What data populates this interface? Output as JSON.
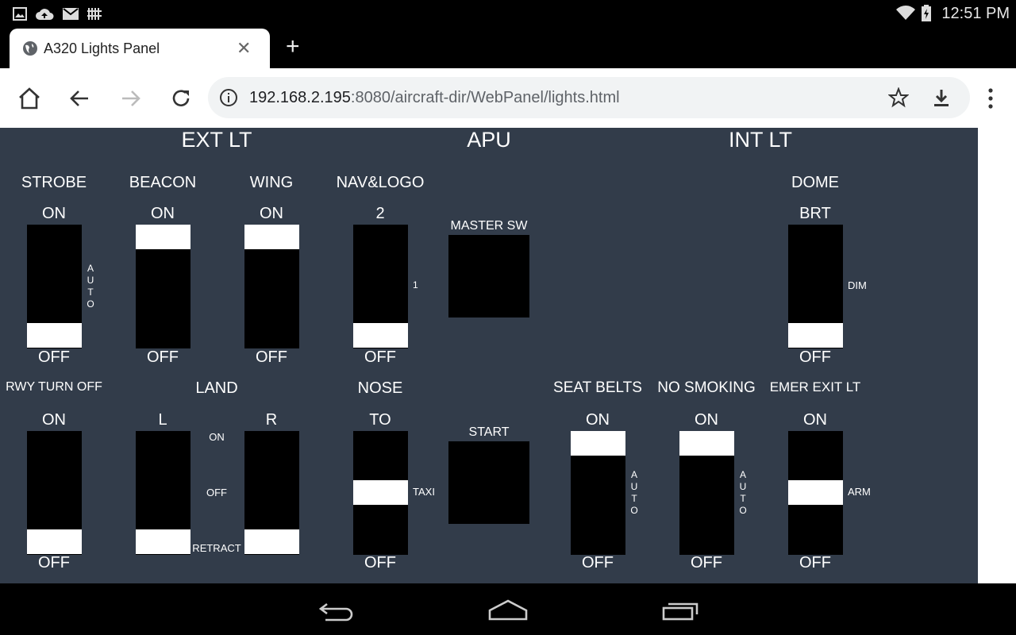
{
  "status_bar": {
    "time": "12:51 PM"
  },
  "browser": {
    "tab_title": "A320 Lights Panel",
    "url_host": "192.168.2.195",
    "url_path": ":8080/aircraft-dir/WebPanel/lights.html"
  },
  "panel": {
    "sections": {
      "ext_lt": "EXT LT",
      "apu": "APU",
      "int_lt": "INT LT"
    },
    "strobe": {
      "title": "STROBE",
      "top": "ON",
      "bottom": "OFF",
      "mid": "AUTO",
      "position": "OFF"
    },
    "beacon": {
      "title": "BEACON",
      "top": "ON",
      "bottom": "OFF",
      "position": "ON"
    },
    "wing": {
      "title": "WING",
      "top": "ON",
      "bottom": "OFF",
      "position": "ON"
    },
    "nav_logo": {
      "title": "NAV&LOGO",
      "top": "2",
      "bottom": "OFF",
      "mid": "1",
      "position": "OFF"
    },
    "apu_master": {
      "title": "MASTER SW"
    },
    "apu_start": {
      "title": "START"
    },
    "dome": {
      "title": "DOME",
      "top": "BRT",
      "bottom": "OFF",
      "mid": "DIM",
      "position": "OFF"
    },
    "rwy_turn_off": {
      "title": "RWY TURN OFF",
      "top": "ON",
      "bottom": "OFF",
      "position": "OFF"
    },
    "land": {
      "title": "LAND",
      "left": "L",
      "right": "R",
      "on": "ON",
      "off": "OFF",
      "retract": "RETRACT",
      "left_position": "RETRACT",
      "right_position": "RETRACT"
    },
    "nose": {
      "title": "NOSE",
      "top": "TO",
      "bottom": "OFF",
      "mid": "TAXI",
      "position": "TAXI"
    },
    "seat_belts": {
      "title": "SEAT BELTS",
      "top": "ON",
      "bottom": "OFF",
      "mid": "AUTO",
      "position": "ON"
    },
    "no_smoking": {
      "title": "NO SMOKING",
      "top": "ON",
      "bottom": "OFF",
      "mid": "AUTO",
      "position": "ON"
    },
    "emer_exit": {
      "title": "EMER EXIT LT",
      "top": "ON",
      "bottom": "OFF",
      "mid": "ARM",
      "position": "ARM"
    }
  }
}
